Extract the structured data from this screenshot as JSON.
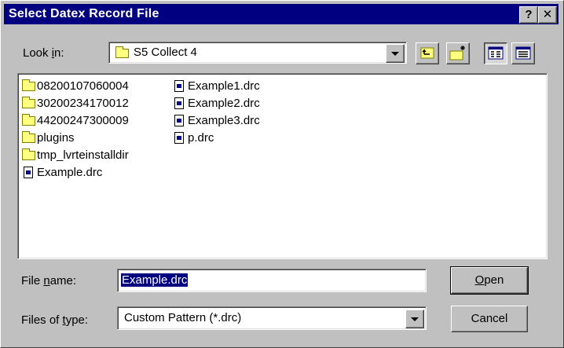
{
  "window": {
    "title": "Select Datex Record File",
    "help_label": "?",
    "close_label": "✕"
  },
  "lookin": {
    "label_pre": "Look ",
    "label_u": "i",
    "label_post": "n:",
    "value": "S5 Collect 4"
  },
  "toolbar": {
    "up_folder": "up-one-level-icon",
    "new_folder": "new-folder-icon",
    "list_view": "list-view-icon",
    "details_view": "details-view-icon"
  },
  "files": {
    "column1": [
      {
        "name": "08200107060004",
        "type": "folder"
      },
      {
        "name": "30200234170012",
        "type": "folder"
      },
      {
        "name": "44200247300009",
        "type": "folder"
      },
      {
        "name": "plugins",
        "type": "folder"
      },
      {
        "name": "tmp_lvrteinstalldir",
        "type": "folder"
      },
      {
        "name": "Example.drc",
        "type": "file"
      }
    ],
    "column2": [
      {
        "name": "Example1.drc",
        "type": "file"
      },
      {
        "name": "Example2.drc",
        "type": "file"
      },
      {
        "name": "Example3.drc",
        "type": "file"
      },
      {
        "name": "p.drc",
        "type": "file"
      }
    ]
  },
  "filename": {
    "label_pre": "File ",
    "label_u": "n",
    "label_post": "ame:",
    "value": "Example.drc"
  },
  "filetype": {
    "label_pre": "Files of ",
    "label_u": "t",
    "label_post": "ype:",
    "value": "Custom Pattern (*.drc)"
  },
  "buttons": {
    "open_u": "O",
    "open_rest": "pen",
    "cancel": "Cancel"
  },
  "colors": {
    "titlebar": "#000080",
    "face": "#c0c0c0",
    "selection": "#000080"
  }
}
